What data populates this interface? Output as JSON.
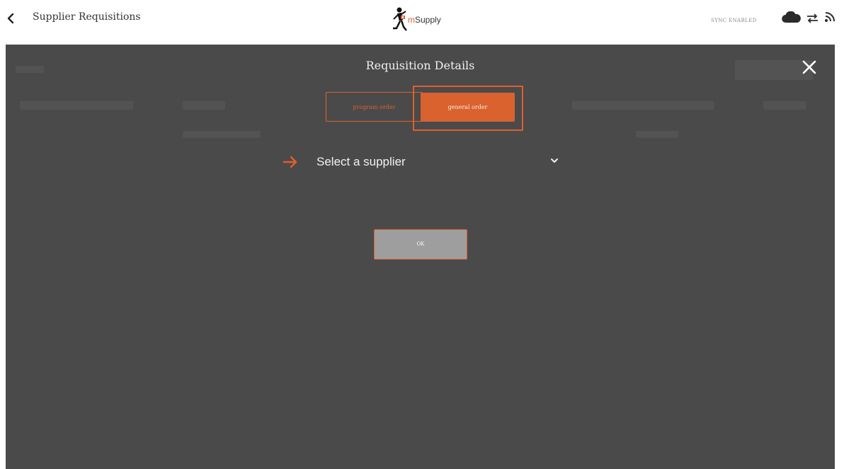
{
  "header": {
    "back_icon": "chevron-left-icon",
    "title": "Supplier Requisitions",
    "logo": {
      "text_m": "m",
      "text_rest": "Supply",
      "icon": "running-figure-logo"
    },
    "sync_status": "SYNC ENABLED",
    "icons": [
      "cloud-icon",
      "sync-icon",
      "feed-icon"
    ]
  },
  "modal": {
    "title": "Requisition Details",
    "close_icon": "close-icon",
    "tabs": [
      {
        "label": "program order",
        "selected": false
      },
      {
        "label": "general order",
        "selected": true
      }
    ],
    "supplier": {
      "placeholder": "Select a supplier",
      "indicator_icon": "arrow-right-icon",
      "dropdown_icon": "chevron-down-icon"
    },
    "ok_label": "OK"
  },
  "colors": {
    "accent": "#d9622f",
    "modal_bg": "#4a4a4a",
    "ok_button_bg": "#9e9e9e"
  }
}
